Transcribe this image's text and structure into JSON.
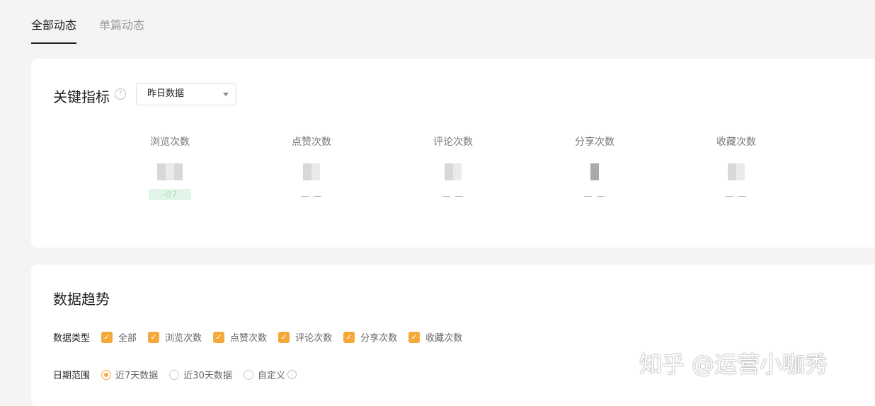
{
  "tabs": [
    {
      "label": "全部动态",
      "active": true
    },
    {
      "label": "单篇动态",
      "active": false
    }
  ],
  "key_metrics": {
    "title": "关键指标",
    "help_icon": "question-circle-icon",
    "select_value": "昨日数据",
    "metrics": [
      {
        "label": "浏览次数",
        "change": "-07"
      },
      {
        "label": "点赞次数",
        "change": "— —"
      },
      {
        "label": "评论次数",
        "change": "— —"
      },
      {
        "label": "分享次数",
        "change": "— —"
      },
      {
        "label": "收藏次数",
        "change": "— —"
      }
    ]
  },
  "trend": {
    "title": "数据趋势",
    "type_label": "数据类型",
    "types": [
      "全部",
      "浏览次数",
      "点赞次数",
      "评论次数",
      "分享次数",
      "收藏次数"
    ],
    "range_label": "日期范围",
    "ranges": [
      {
        "label": "近7天数据",
        "selected": true
      },
      {
        "label": "近30天数据",
        "selected": false
      },
      {
        "label": "自定义",
        "selected": false
      }
    ]
  },
  "watermark": "知乎 @运营小咖秀",
  "colors": {
    "accent": "#f5a93a",
    "background": "#f4f4f4"
  }
}
